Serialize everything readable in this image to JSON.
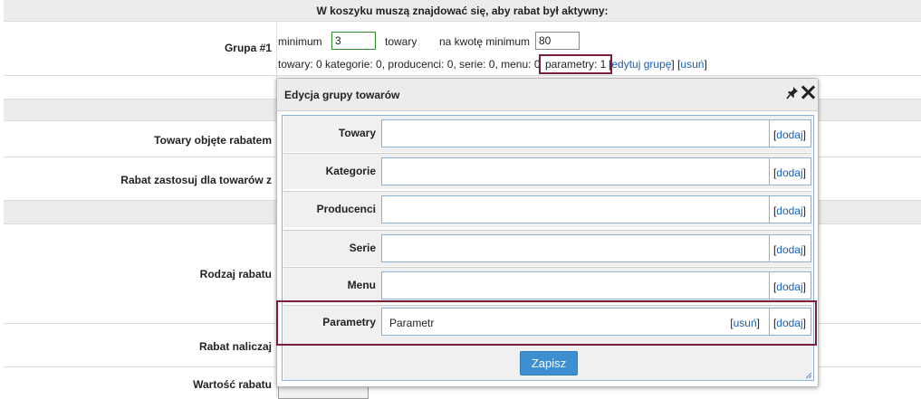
{
  "form": {
    "header": "W koszyku muszą znajdować się, aby rabat był aktywny:",
    "group_label": "Grupa #1",
    "minimum_label": "minimum",
    "minimum_value": "3",
    "units_label": "towary",
    "amount_label": "na kwotę minimum",
    "amount_value": "80",
    "summary_prefix": "towary: 0 kategorie: 0, producenci: 0, serie: 0, menu: 0",
    "params_summary": "parametry: 1",
    "edit_group": "edytuj grupę",
    "remove": "usuń",
    "covered_label": "Towary objęte rabatem",
    "apply_label": "Rabat zastosuj dla towarów z",
    "type_label": "Rodzaj rabatu",
    "calc_label": "Rabat naliczaj",
    "value_label": "Wartość rabatu"
  },
  "dialog": {
    "title": "Edycja grupy towarów",
    "rows": [
      {
        "label": "Towary",
        "add": "dodaj"
      },
      {
        "label": "Kategorie",
        "add": "dodaj"
      },
      {
        "label": "Producenci",
        "add": "dodaj"
      },
      {
        "label": "Serie",
        "add": "dodaj"
      },
      {
        "label": "Menu",
        "add": "dodaj"
      },
      {
        "label": "Parametry",
        "item": "Parametr",
        "remove": "usuń",
        "add": "dodaj"
      }
    ],
    "save_label": "Zapisz"
  },
  "colors": {
    "highlight": "#7b1e3a",
    "link": "#1a5fb4",
    "save_button": "#3d8fd1",
    "dialog_border": "#8ab1d8"
  }
}
